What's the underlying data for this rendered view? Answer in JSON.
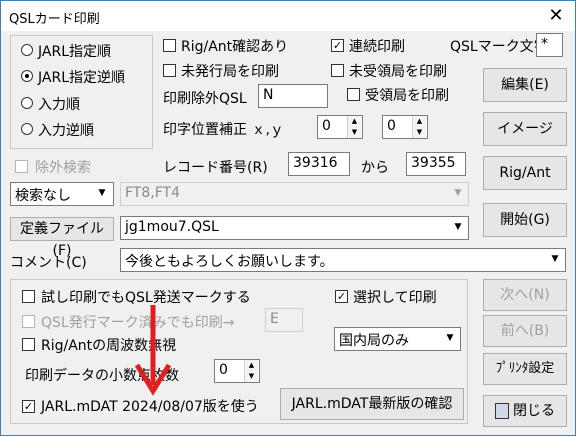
{
  "window": {
    "title": "QSLカード印刷",
    "close_glyph": "✕"
  },
  "order_radios": [
    {
      "label": "JARL指定順",
      "selected": false
    },
    {
      "label": "JARL指定逆順",
      "selected": true
    },
    {
      "label": "入力順",
      "selected": false
    },
    {
      "label": "入力逆順",
      "selected": false
    }
  ],
  "options": {
    "rig_ant": {
      "label": "Rig/Ant確認あり",
      "checked": false
    },
    "continuous": {
      "label": "連続印刷",
      "checked": true,
      "mark": "✓"
    },
    "qsl_mark_label": "QSLマーク文字",
    "qsl_mark_value": "*",
    "unissued": {
      "label": "未発行局を印刷",
      "checked": false
    },
    "unreceived": {
      "label": "未受領局を印刷",
      "checked": false
    },
    "exclude_qsl_label": "印刷除外QSL",
    "exclude_qsl_value": "N",
    "received": {
      "label": "受領局を印刷",
      "checked": false
    },
    "position_label": "印字位置補正 ｘ,ｙ",
    "pos_x": "0",
    "pos_y": "0"
  },
  "search": {
    "exclude_label": "除外検索",
    "record_label": "レコード番号(R)",
    "record_from": "39316",
    "to_label": "から",
    "record_to": "39355",
    "mode": "検索なし",
    "mode_value": "FT8,FT4",
    "def_file_button": "定義ファイル(F)",
    "def_file_value": "jg1mou7.QSL",
    "comment_label": "コメント(C)",
    "comment_value": "今後ともよろしくお願いします。"
  },
  "lower": {
    "test_print": {
      "label": "試し印刷でもQSL発送マークする",
      "checked": false
    },
    "select_print": {
      "label": "選択して印刷",
      "checked": true,
      "mark": "✓"
    },
    "qsl_issued_print": {
      "label": "QSL発行マーク済みでも印刷→",
      "checked": false
    },
    "qsl_issued_value": "E",
    "rig_ant_frequency": {
      "label": "Rig/Antの周波数無視",
      "checked": false
    },
    "domestic": "国内局のみ",
    "decimal_label": "印刷データの小数点枚数",
    "decimal_value": "0",
    "jarl_mdat": {
      "label": "JARL.mDAT 2024/08/07版を使う",
      "checked": true,
      "mark": "✓"
    },
    "jarl_latest_button": "JARL.mDAT最新版の確認"
  },
  "side_buttons": {
    "edit": "編集(E)",
    "image": "イメージ",
    "rig_ant": "Rig/Ant",
    "start": "開始(G)",
    "next": "次へ(N)",
    "prev": "前へ(B)",
    "printer": "ﾌﾟﾘﾝﾀ設定",
    "close": "閉じる"
  },
  "colors": {
    "annotation_arrow": "#e02020",
    "accent_border": "#0078d7"
  }
}
